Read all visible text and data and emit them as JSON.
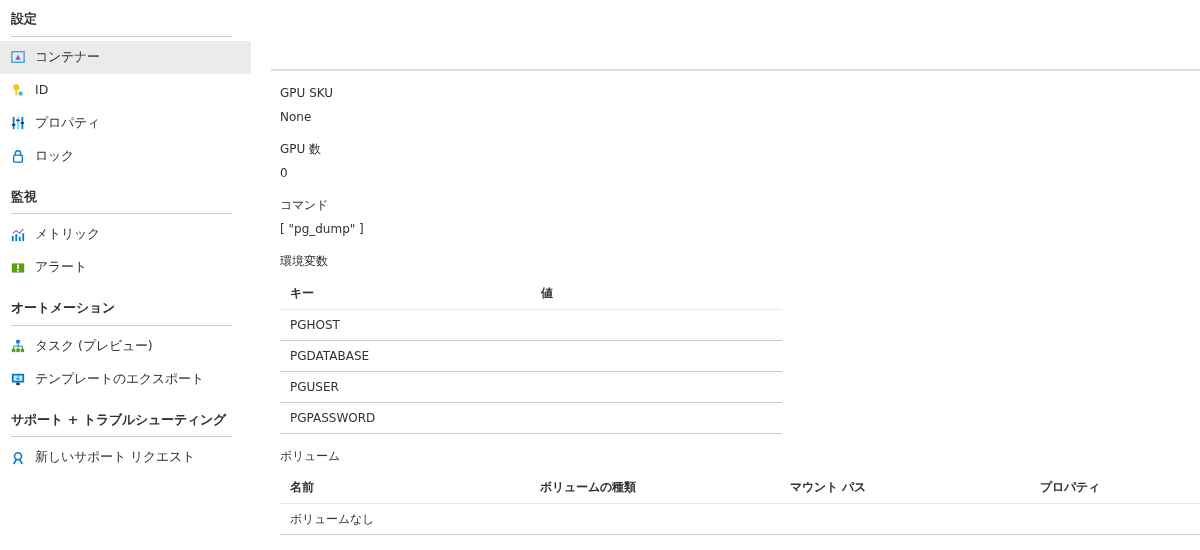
{
  "sidebar": {
    "sections": [
      {
        "title": "設定",
        "items": [
          {
            "label": "コンテナー",
            "kind": "container",
            "selected": true
          },
          {
            "label": "ID",
            "kind": "id",
            "selected": false
          },
          {
            "label": "プロパティ",
            "kind": "properties",
            "selected": false
          },
          {
            "label": "ロック",
            "kind": "lock",
            "selected": false
          }
        ]
      },
      {
        "title": "監視",
        "items": [
          {
            "label": "メトリック",
            "kind": "metrics",
            "selected": false
          },
          {
            "label": "アラート",
            "kind": "alert",
            "selected": false
          }
        ]
      },
      {
        "title": "オートメーション",
        "items": [
          {
            "label": "タスク (プレビュー)",
            "kind": "tasks",
            "selected": false
          },
          {
            "label": "テンプレートのエクスポート",
            "kind": "export",
            "selected": false
          }
        ]
      },
      {
        "title": "サポート + トラブルシューティング",
        "items": [
          {
            "label": "新しいサポート リクエスト",
            "kind": "support",
            "selected": false
          }
        ]
      }
    ]
  },
  "fields": [
    {
      "label": "GPU SKU",
      "value": "None"
    },
    {
      "label": "GPU 数",
      "value": "0"
    },
    {
      "label": "コマンド",
      "value": "[ \"pg_dump\" ]"
    }
  ],
  "env_vars": {
    "title": "環境変数",
    "columns": [
      "キー",
      "値"
    ],
    "rows": [
      {
        "key": "PGHOST"
      },
      {
        "key": "PGDATABASE"
      },
      {
        "key": "PGUSER"
      },
      {
        "key": "PGPASSWORD"
      }
    ]
  },
  "volumes": {
    "title": "ボリューム",
    "columns": [
      "名前",
      "ボリュームの種類",
      "マウント パス",
      "プロパティ"
    ],
    "empty_message": "ボリュームなし"
  }
}
